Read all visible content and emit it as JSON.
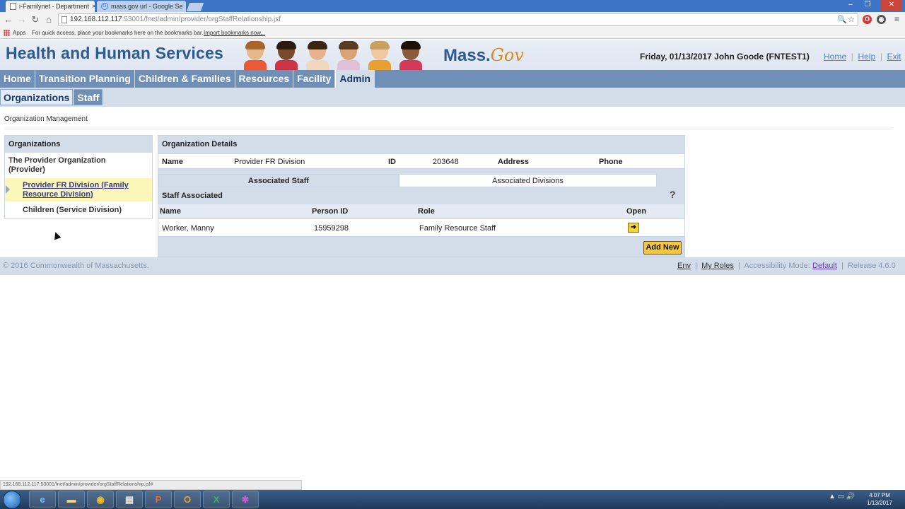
{
  "browser": {
    "tabs": [
      {
        "title": "i-Familynet - Department",
        "active": true
      },
      {
        "title": "mass.gov url - Google Se",
        "active": false
      }
    ],
    "url_host": "192.168.112.117",
    "url_port": ":53001",
    "url_path": "/fnet/admin/provider/orgStaffRelationship.jsf",
    "bookmarks": {
      "apps_label": "Apps",
      "hint": "For quick access, place your bookmarks here on the bookmarks bar.",
      "import_link": "Import bookmarks now..."
    },
    "status_url": "192.168.112.117:53001/fnet/admin/provider/orgStaffRelationship.jsf#"
  },
  "header": {
    "title": "Health and Human Services",
    "mass_gov_prefix": "Mass.",
    "mass_gov_suffix": "Gov",
    "user_info": "Friday, 01/13/2017  John Goode  (FNTEST1)",
    "links": {
      "home": "Home",
      "help": "Help",
      "exit": "Exit"
    }
  },
  "nav": {
    "primary": [
      "Home",
      "Transition Planning",
      "Children & Families",
      "Resources",
      "Facility",
      "Admin"
    ],
    "active_primary": "Admin",
    "secondary": [
      "Organizations",
      "Staff"
    ],
    "active_secondary": "Staff"
  },
  "breadcrumb": "Organization Management",
  "organizations": {
    "heading": "Organizations",
    "root": "The Provider Organization (Provider)",
    "selected": "Provider FR Division (Family Resource Division)",
    "child": "Children (Service Division)"
  },
  "org_details": {
    "heading": "Organization Details",
    "name_label": "Name",
    "name_value": "Provider FR Division",
    "id_label": "ID",
    "id_value": "203648",
    "address_label": "Address",
    "phone_label": "Phone",
    "tabs": [
      "Associated Staff",
      "Associated Divisions"
    ],
    "active_tab": "Associated Staff",
    "staff_heading": "Staff Associated",
    "help_icon": "?",
    "columns": [
      "Name",
      "Person ID",
      "Role",
      "Open"
    ],
    "rows": [
      {
        "name": "Worker, Manny",
        "person_id": "15959298",
        "role": "Family Resource Staff"
      }
    ],
    "open_icon": "arrow-right-icon",
    "add_new_label": "Add New"
  },
  "footer": {
    "copyright": "© 2016 Commonwealth of Massachusetts.",
    "env": "Env",
    "my_roles": "My Roles",
    "accessibility_label": "Accessibility Mode:",
    "accessibility_value": "Default",
    "release": "Release 4.6.0"
  },
  "taskbar": {
    "time": "4:07 PM",
    "date": "1/13/2017"
  }
}
